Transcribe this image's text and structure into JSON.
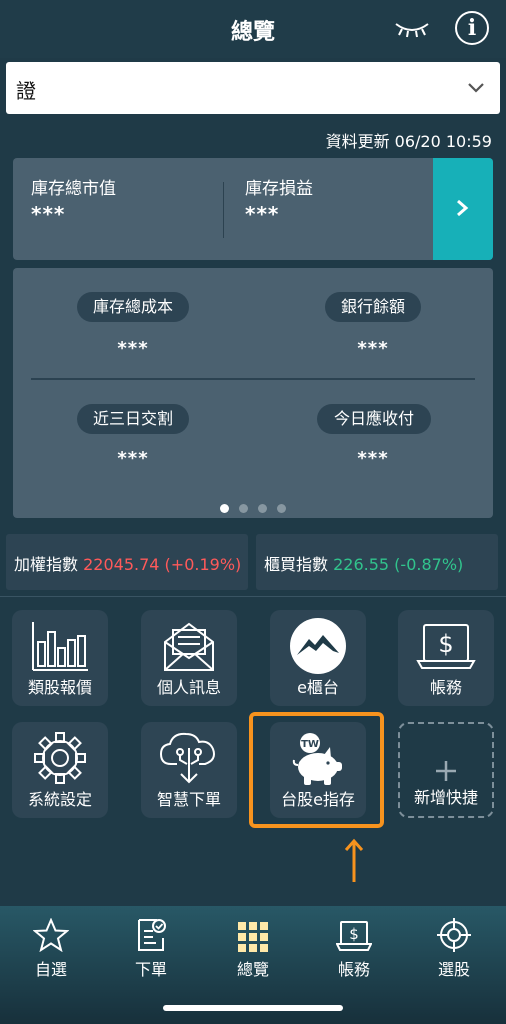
{
  "header": {
    "title": "總覽",
    "eye_icon": "eye-closed-icon",
    "info_icon": "info-icon"
  },
  "account_select": {
    "value": "證",
    "chevron_icon": "chevron-down-icon"
  },
  "updated": "資料更新 06/20 10:59",
  "summary": {
    "market_value_label": "庫存總市值",
    "market_value": "***",
    "pnl_label": "庫存損益",
    "pnl": "***"
  },
  "detail": {
    "cost_label": "庫存總成本",
    "cost": "***",
    "bank_label": "銀行餘額",
    "bank": "***",
    "settle_label": "近三日交割",
    "settle": "***",
    "receivable_label": "今日應收付",
    "receivable": "***",
    "page_dots": 4,
    "active_dot": 1
  },
  "indices": [
    {
      "name": "加權指數",
      "value": "22045.74 (+0.19%)",
      "direction": "up"
    },
    {
      "name": "櫃買指數",
      "value": "226.55 (-0.87%)",
      "direction": "down"
    }
  ],
  "shortcuts": [
    {
      "label": "類股報價",
      "icon": "bar-chart-icon"
    },
    {
      "label": "個人訊息",
      "icon": "mail-icon"
    },
    {
      "label": "e櫃台",
      "icon": "mountain-logo-icon"
    },
    {
      "label": "帳務",
      "icon": "dollar-monitor-icon"
    },
    {
      "label": "系統設定",
      "icon": "gear-icon"
    },
    {
      "label": "智慧下單",
      "icon": "cloud-download-icon"
    },
    {
      "label": "台股e指存",
      "icon": "piggy-bank-icon",
      "badge": "TW",
      "highlighted": true
    },
    {
      "label": "新增快捷",
      "icon": "plus-icon"
    }
  ],
  "tabs": [
    {
      "label": "自選",
      "icon": "star-icon"
    },
    {
      "label": "下單",
      "icon": "order-form-icon"
    },
    {
      "label": "總覽",
      "icon": "grid-icon",
      "active": true
    },
    {
      "label": "帳務",
      "icon": "dollar-monitor-icon"
    },
    {
      "label": "選股",
      "icon": "target-icon"
    }
  ],
  "colors": {
    "accent": "#17b0b8",
    "up": "#ff5a5a",
    "down": "#31c48d",
    "highlight": "#f7931e"
  }
}
